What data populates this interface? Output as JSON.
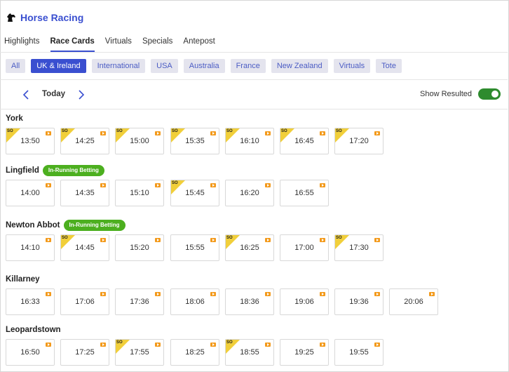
{
  "header": {
    "title": "Horse Racing",
    "icon": "horse-head-icon"
  },
  "tabs": [
    {
      "label": "Highlights",
      "active": false
    },
    {
      "label": "Race Cards",
      "active": true
    },
    {
      "label": "Virtuals",
      "active": false
    },
    {
      "label": "Specials",
      "active": false
    },
    {
      "label": "Antepost",
      "active": false
    }
  ],
  "regions": [
    {
      "label": "All",
      "active": false
    },
    {
      "label": "UK & Ireland",
      "active": true
    },
    {
      "label": "International",
      "active": false
    },
    {
      "label": "USA",
      "active": false
    },
    {
      "label": "Australia",
      "active": false
    },
    {
      "label": "France",
      "active": false
    },
    {
      "label": "New Zealand",
      "active": false
    },
    {
      "label": "Virtuals",
      "active": false
    },
    {
      "label": "Tote",
      "active": false
    }
  ],
  "date_nav": {
    "label": "Today",
    "show_resulted_label": "Show Resulted",
    "show_resulted_on": true
  },
  "colors": {
    "accent": "#3a4fd0",
    "toggle_on": "#2e8b2e",
    "in_running": "#4caf1f",
    "so_badge": "#f1cf3a",
    "stream": "#f39a1c"
  },
  "badge_labels": {
    "so": "SO",
    "in_running": "In-Running Betting"
  },
  "meetings": [
    {
      "name": "York",
      "in_running": false,
      "races": [
        {
          "time": "13:50",
          "so": true
        },
        {
          "time": "14:25",
          "so": true
        },
        {
          "time": "15:00",
          "so": true
        },
        {
          "time": "15:35",
          "so": true
        },
        {
          "time": "16:10",
          "so": true
        },
        {
          "time": "16:45",
          "so": true
        },
        {
          "time": "17:20",
          "so": true
        }
      ]
    },
    {
      "name": "Lingfield",
      "in_running": true,
      "races": [
        {
          "time": "14:00",
          "so": false
        },
        {
          "time": "14:35",
          "so": false
        },
        {
          "time": "15:10",
          "so": false
        },
        {
          "time": "15:45",
          "so": true
        },
        {
          "time": "16:20",
          "so": false
        },
        {
          "time": "16:55",
          "so": false
        }
      ]
    },
    {
      "name": "Newton Abbot",
      "in_running": true,
      "races": [
        {
          "time": "14:10",
          "so": false
        },
        {
          "time": "14:45",
          "so": true
        },
        {
          "time": "15:20",
          "so": false
        },
        {
          "time": "15:55",
          "so": false
        },
        {
          "time": "16:25",
          "so": true
        },
        {
          "time": "17:00",
          "so": false
        },
        {
          "time": "17:30",
          "so": true
        }
      ]
    },
    {
      "name": "Killarney",
      "in_running": false,
      "races": [
        {
          "time": "16:33",
          "so": false
        },
        {
          "time": "17:06",
          "so": false
        },
        {
          "time": "17:36",
          "so": false
        },
        {
          "time": "18:06",
          "so": false
        },
        {
          "time": "18:36",
          "so": false
        },
        {
          "time": "19:06",
          "so": false
        },
        {
          "time": "19:36",
          "so": false
        },
        {
          "time": "20:06",
          "so": false
        }
      ]
    },
    {
      "name": "Leopardstown",
      "in_running": false,
      "races": [
        {
          "time": "16:50",
          "so": false
        },
        {
          "time": "17:25",
          "so": false
        },
        {
          "time": "17:55",
          "so": true
        },
        {
          "time": "18:25",
          "so": false
        },
        {
          "time": "18:55",
          "so": true
        },
        {
          "time": "19:25",
          "so": false
        },
        {
          "time": "19:55",
          "so": false
        }
      ]
    }
  ]
}
